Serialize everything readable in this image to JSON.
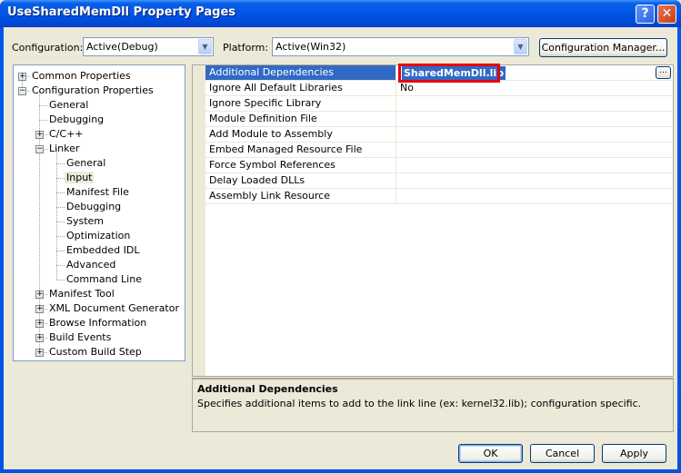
{
  "window": {
    "title": "UseSharedMemDll Property Pages",
    "help_label": "?",
    "close_label": "✕"
  },
  "toolbar": {
    "configuration_label": "Configuration:",
    "configuration_value": "Active(Debug)",
    "platform_label": "Platform:",
    "platform_value": "Active(Win32)",
    "config_manager_label": "Configuration Manager..."
  },
  "tree": {
    "items": [
      {
        "label": "Common Properties",
        "expander": "+"
      },
      {
        "label": "Configuration Properties",
        "expander": "−"
      },
      {
        "label": "General"
      },
      {
        "label": "Debugging"
      },
      {
        "label": "C/C++",
        "expander": "+"
      },
      {
        "label": "Linker",
        "expander": "−"
      },
      {
        "label": "General"
      },
      {
        "label": "Input",
        "selected": true
      },
      {
        "label": "Manifest File"
      },
      {
        "label": "Debugging"
      },
      {
        "label": "System"
      },
      {
        "label": "Optimization"
      },
      {
        "label": "Embedded IDL"
      },
      {
        "label": "Advanced"
      },
      {
        "label": "Command Line"
      },
      {
        "label": "Manifest Tool",
        "expander": "+"
      },
      {
        "label": "XML Document Generator",
        "expander": "+"
      },
      {
        "label": "Browse Information",
        "expander": "+"
      },
      {
        "label": "Build Events",
        "expander": "+"
      },
      {
        "label": "Custom Build Step",
        "expander": "+"
      }
    ]
  },
  "grid": {
    "rows": [
      {
        "name": "Additional Dependencies",
        "value": "SharedMemDll.lib",
        "selected": true
      },
      {
        "name": "Ignore All Default Libraries",
        "value": "No"
      },
      {
        "name": "Ignore Specific Library",
        "value": ""
      },
      {
        "name": "Module Definition File",
        "value": ""
      },
      {
        "name": "Add Module to Assembly",
        "value": ""
      },
      {
        "name": "Embed Managed Resource File",
        "value": ""
      },
      {
        "name": "Force Symbol References",
        "value": ""
      },
      {
        "name": "Delay Loaded DLLs",
        "value": ""
      },
      {
        "name": "Assembly Link Resource",
        "value": ""
      }
    ],
    "ellipsis_label": "..."
  },
  "description": {
    "title": "Additional Dependencies",
    "text": "Specifies additional items to add to the link line (ex: kernel32.lib); configuration specific."
  },
  "buttons": {
    "ok": "OK",
    "cancel": "Cancel",
    "apply": "Apply"
  },
  "colors": {
    "selection": "#316ac5",
    "highlight_box": "#e8000c",
    "titlebar": "#0055e5"
  }
}
